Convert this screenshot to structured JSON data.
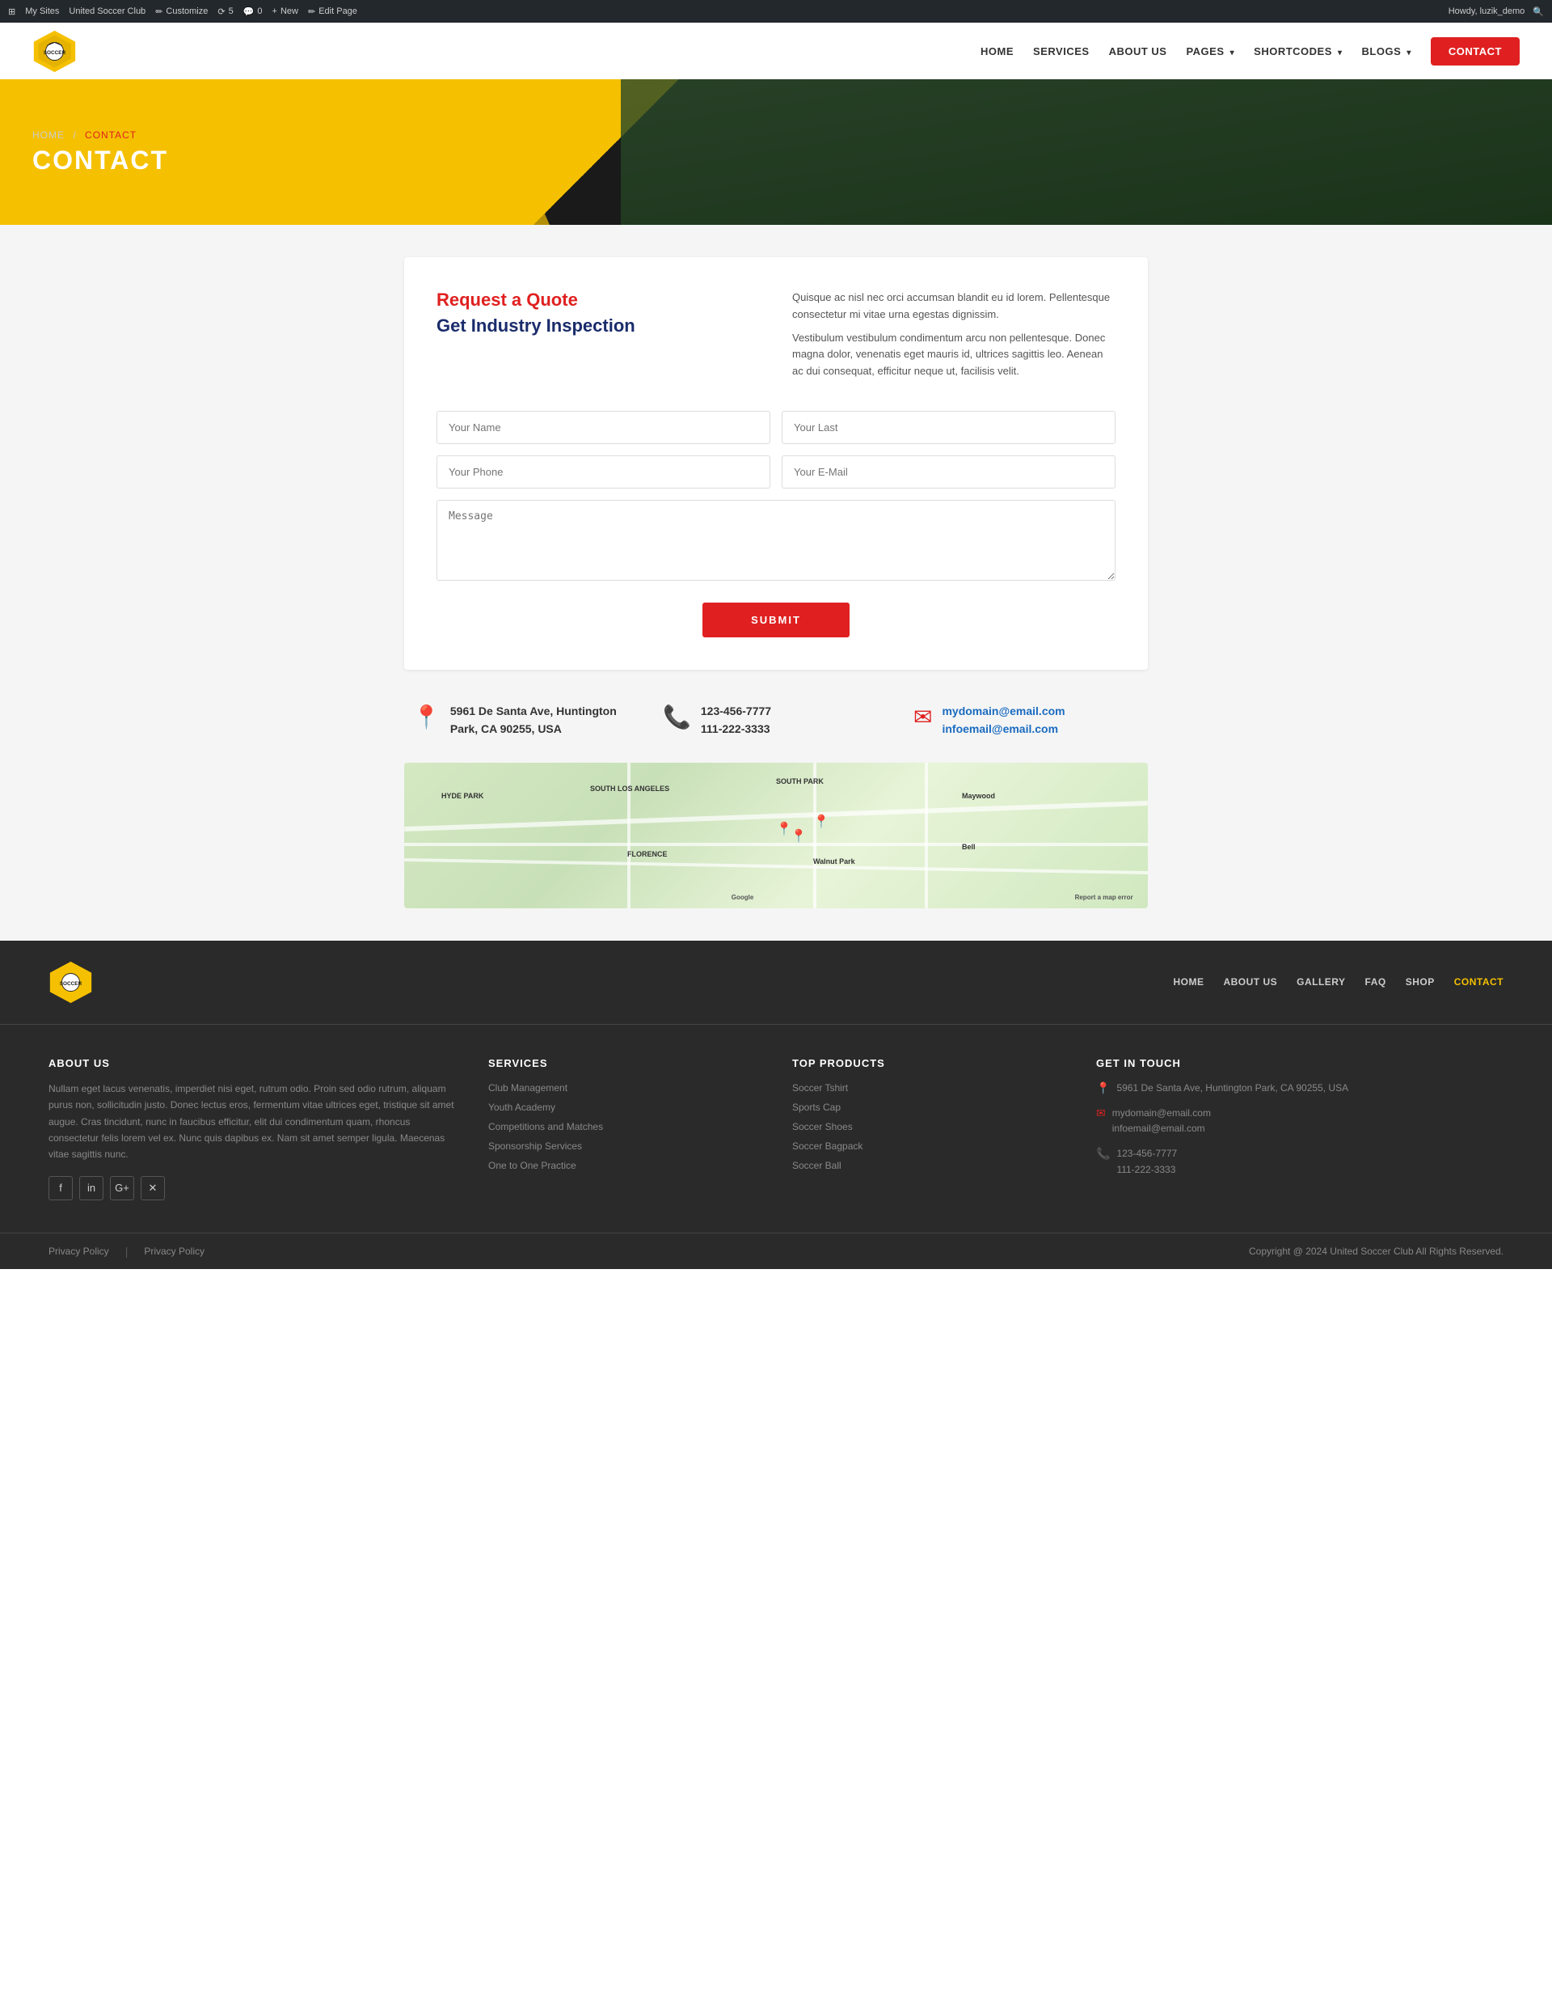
{
  "admin_bar": {
    "wp_icon": "⊞",
    "sites": "My Sites",
    "site_name": "United Soccer Club",
    "customize": "Customize",
    "updates": "5",
    "comments": "0",
    "new": "New",
    "edit_page": "Edit Page",
    "howdy": "Howdy, luzik_demo",
    "search_icon": "🔍"
  },
  "header": {
    "logo_alt": "Soccer Club Logo",
    "nav": [
      {
        "label": "HOME",
        "url": "#",
        "active": false
      },
      {
        "label": "SERVICES",
        "url": "#",
        "active": false
      },
      {
        "label": "ABOUT US",
        "url": "#",
        "active": false
      },
      {
        "label": "PAGES",
        "url": "#",
        "active": false,
        "dropdown": true
      },
      {
        "label": "SHORTCODES",
        "url": "#",
        "active": false,
        "dropdown": true
      },
      {
        "label": "BLOGS",
        "url": "#",
        "active": false,
        "dropdown": true
      }
    ],
    "contact_button": "Contact"
  },
  "hero": {
    "breadcrumb_home": "HOME",
    "breadcrumb_sep": "/",
    "breadcrumb_current": "CONTACT",
    "title": "CONTACT"
  },
  "quote_section": {
    "heading_red": "Request a Quote",
    "heading_blue": "Get Industry Inspection",
    "description_1": "Quisque ac nisl nec orci accumsan blandit eu id lorem. Pellentesque consectetur mi vitae urna egestas dignissim.",
    "description_2": "Vestibulum vestibulum condimentum arcu non pellentesque. Donec magna dolor, venenatis eget mauris id, ultrices sagittis leo. Aenean ac dui consequat, efficitur neque ut, facilisis velit."
  },
  "form": {
    "first_name_placeholder": "Your Name",
    "last_name_placeholder": "Your Last",
    "phone_placeholder": "Your Phone",
    "email_placeholder": "Your E-Mail",
    "message_placeholder": "Message",
    "submit_label": "SUBMIT"
  },
  "contact_info": [
    {
      "icon": "📍",
      "line1": "5961 De Santa Ave, Huntington",
      "line2": "Park, CA 90255, USA"
    },
    {
      "icon": "📞",
      "line1": "123-456-7777",
      "line2": "111-222-3333"
    },
    {
      "icon": "✉",
      "line1": "mydomain@email.com",
      "line2": "infoemail@email.com"
    }
  ],
  "footer": {
    "nav_links": [
      {
        "label": "HOME",
        "active": false
      },
      {
        "label": "ABOUT US",
        "active": false
      },
      {
        "label": "GALLERY",
        "active": false
      },
      {
        "label": "FAQ",
        "active": false
      },
      {
        "label": "SHOP",
        "active": false
      },
      {
        "label": "CONTACT",
        "active": true
      }
    ],
    "about_title": "ABOUT US",
    "about_text": "Nullam eget lacus venenatis, imperdiet nisi eget, rutrum odio. Proin sed odio rutrum, aliquam purus non, sollicitudin justo. Donec lectus eros, fermentum vitae ultrices eget, tristique sit amet augue. Cras tincidunt, nunc in faucibus efficitur, elit dui condimentum quam, rhoncus consectetur felis lorem vel ex. Nunc quis dapibus ex. Nam sit amet semper ligula. Maecenas vitae sagittis nunc.",
    "services_title": "SERVICES",
    "services": [
      {
        "label": "Club Management"
      },
      {
        "label": "Youth Academy"
      },
      {
        "label": "Competitions and Matches"
      },
      {
        "label": "Sponsorship Services"
      },
      {
        "label": "One to One Practice"
      }
    ],
    "products_title": "Top Products",
    "products": [
      {
        "label": "Soccer Tshirt"
      },
      {
        "label": "Sports Cap"
      },
      {
        "label": "Soccer Shoes"
      },
      {
        "label": "Soccer Bagpack"
      },
      {
        "label": "Soccer Ball"
      }
    ],
    "get_in_touch_title": "GET IN TOUCH",
    "address": "5961 De Santa Ave, Huntington Park, CA 90255, USA",
    "email1": "mydomain@email.com",
    "email2": "infoemail@email.com",
    "phone1": "123-456-7777",
    "phone2": "111-222-3333",
    "social": [
      {
        "icon": "f",
        "name": "facebook"
      },
      {
        "icon": "in",
        "name": "instagram"
      },
      {
        "icon": "G+",
        "name": "google-plus"
      },
      {
        "icon": "✕",
        "name": "twitter"
      }
    ],
    "privacy_policy_1": "Privacy Policy",
    "privacy_policy_2": "Privacy Policy",
    "copyright": "Copyright @ 2024 United Soccer Club All Rights Reserved."
  }
}
